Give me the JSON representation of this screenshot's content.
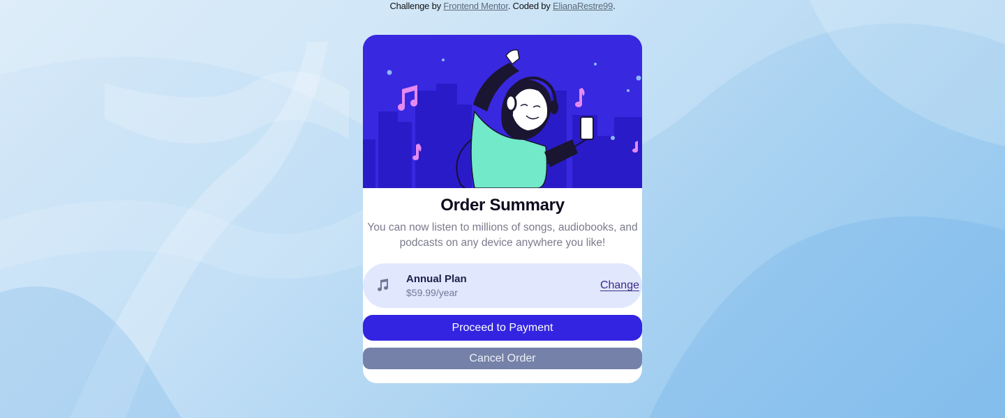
{
  "attribution": {
    "prefix": "Challenge by ",
    "challenge_link": "Frontend Mentor",
    "middle": ". Coded by ",
    "author_link": "ElianaRestre99",
    "suffix": "."
  },
  "card": {
    "title": "Order Summary",
    "description": "You can now listen to millions of songs, audiobooks, and podcasts on any device anywhere you like!",
    "plan": {
      "icon": "music-note-icon",
      "name": "Annual Plan",
      "price": "$59.99/year",
      "change_label": "Change"
    },
    "primary_button": "Proceed to Payment",
    "secondary_button": "Cancel Order"
  },
  "colors": {
    "hero_background": "#3828e0",
    "primary": "#3224e0",
    "secondary": "#7581a8",
    "plan_background": "#e1e7fd",
    "link": "#3c2a86"
  }
}
